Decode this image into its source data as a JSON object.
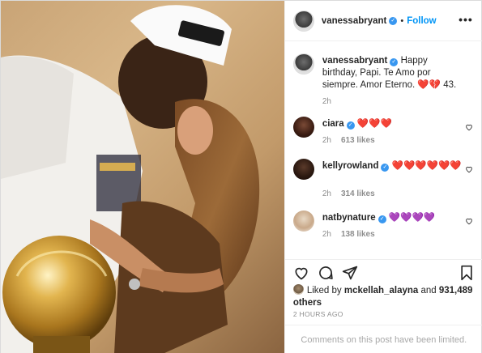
{
  "post": {
    "author": "vanessabryant",
    "separator": "•",
    "follow_label": "Follow",
    "more_label": "•••"
  },
  "caption": {
    "username": "vanessabryant",
    "text": "Happy birthday, Papi. Te Amo por siempre. Amor Eterno. ❤️💔 43.",
    "time": "2h"
  },
  "comments": [
    {
      "username": "ciara",
      "text": "❤️❤️❤️",
      "time": "2h",
      "likes": "613 likes"
    },
    {
      "username": "kellyrowland",
      "text": "❤️❤️❤️❤️❤️❤️",
      "time": "2h",
      "likes": "314 likes"
    },
    {
      "username": "natbynature",
      "text": "💜💜💜💜",
      "time": "2h",
      "likes": "138 likes"
    }
  ],
  "likes": {
    "prefix": "Liked by",
    "user": "mckellah_alayna",
    "joiner": "and",
    "count": "931,489 others"
  },
  "timestamp": "2 HOURS AGO",
  "comments_limited": "Comments on this post have been limited.",
  "icons": {
    "more": "more-options-icon",
    "verified": "verified-badge-icon",
    "like": "heart-icon",
    "comment": "comment-bubble-icon",
    "share": "paper-plane-icon",
    "save": "bookmark-icon"
  },
  "colors": {
    "follow": "#0095f6",
    "verified": "#3897f0",
    "muted": "#8e8e8e"
  }
}
